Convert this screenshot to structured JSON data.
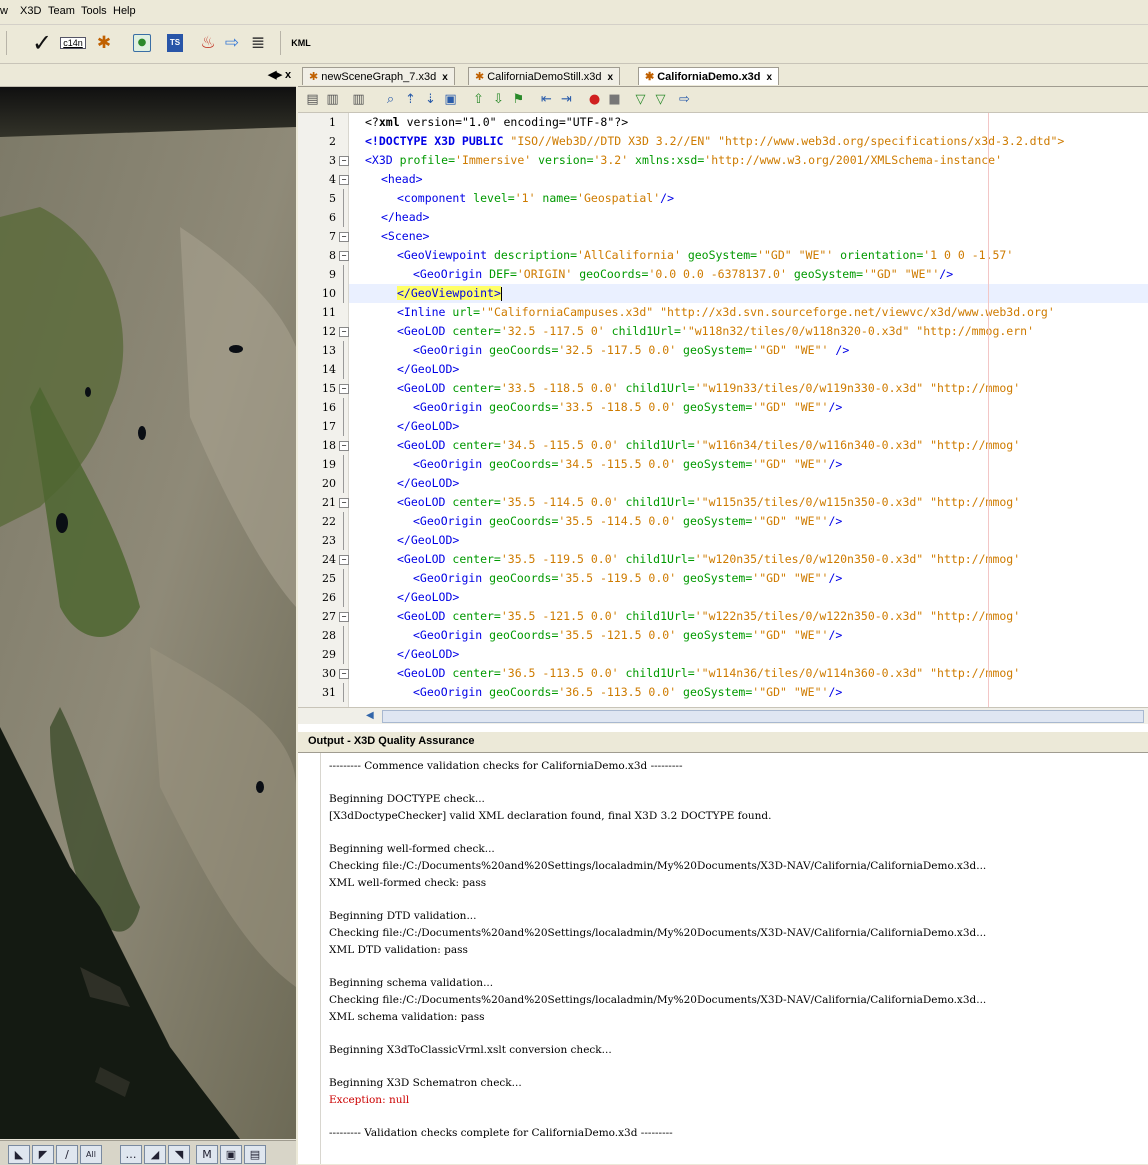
{
  "menu": [
    "w",
    "X3D",
    "Team",
    "Tools",
    "Help"
  ],
  "toolbar": {
    "c14n_label": "c14n",
    "ts_label": "TS",
    "kml_label": "KML"
  },
  "left_panel": {
    "controls": "◀▸ x"
  },
  "map_controls": [
    "◣",
    "◤",
    "∕",
    "All",
    "…",
    "◢",
    "◥",
    "M",
    "▣",
    "▤"
  ],
  "editor": {
    "tabs": [
      {
        "label": "newSceneGraph_7.x3d",
        "close": "x"
      },
      {
        "label": "CaliforniaDemoStill.x3d",
        "close": "x"
      },
      {
        "label": "CaliforniaDemo.x3d",
        "close": "x"
      }
    ],
    "lines": [
      {
        "n": "1"
      },
      {
        "n": "2"
      },
      {
        "n": "3"
      },
      {
        "n": "4"
      },
      {
        "n": "5"
      },
      {
        "n": "6"
      },
      {
        "n": "7"
      },
      {
        "n": "8"
      },
      {
        "n": "9"
      },
      {
        "n": "10"
      },
      {
        "n": "11"
      },
      {
        "n": "12"
      },
      {
        "n": "13"
      },
      {
        "n": "14"
      },
      {
        "n": "15"
      },
      {
        "n": "16"
      },
      {
        "n": "17"
      },
      {
        "n": "18"
      },
      {
        "n": "19"
      },
      {
        "n": "20"
      },
      {
        "n": "21"
      },
      {
        "n": "22"
      },
      {
        "n": "23"
      },
      {
        "n": "24"
      },
      {
        "n": "25"
      },
      {
        "n": "26"
      },
      {
        "n": "27"
      },
      {
        "n": "28"
      },
      {
        "n": "29"
      },
      {
        "n": "30"
      },
      {
        "n": "31"
      }
    ],
    "code": {
      "l1": {
        "a": "<?",
        "b": "xml",
        "c": " version=\"1.0\" encoding=\"UTF-8\"?>"
      },
      "l2": {
        "a": "<!DOCTYPE X3D PUBLIC ",
        "b": "\"ISO//Web3D//DTD X3D 3.2//EN\" \"http://www.web3d.org/specifications/x3d-3.2.dtd\">"
      },
      "l3": {
        "a": "<X3D",
        "b": " profile=",
        "c": "'Immersive'",
        "d": " version=",
        "e": "'3.2'",
        "f": " xmlns:xsd=",
        "g": "'http://www.w3.org/2001/XMLSchema-instance'"
      },
      "l4": {
        "a": "<head>"
      },
      "l5": {
        "a": "<component",
        "b": " level=",
        "c": "'1'",
        "d": " name=",
        "e": "'Geospatial'",
        "f": "/>"
      },
      "l6": {
        "a": "</head>"
      },
      "l7": {
        "a": "<Scene>"
      },
      "l8": {
        "a": "<GeoViewpoint",
        "b": " description=",
        "c": "'AllCalifornia'",
        "d": " geoSystem=",
        "e": "'\"GD\" \"WE\"'",
        "f": " orientation=",
        "g": "'1 0 0 -1.57'"
      },
      "l9": {
        "a": "<GeoOrigin",
        "b": " DEF=",
        "c": "'ORIGIN'",
        "d": " geoCoords=",
        "e": "'0.0 0.0 -6378137.0'",
        "f": " geoSystem=",
        "g": "'\"GD\" \"WE\"'",
        "h": "/>"
      },
      "l10": {
        "a": "</GeoViewpoint",
        "b": ">"
      },
      "l11": {
        "a": "<Inline",
        "b": " url=",
        "c": "'\"CaliforniaCampuses.x3d\" \"http://x3d.svn.sourceforge.net/viewvc/x3d/www.web3d.org'"
      },
      "geolod": [
        {
          "c": "'32.5 -117.5 0'",
          "u": "'\"w118n32/tiles/0/w118n320-0.x3d\" \"http://mmog.ern'",
          "o": "'32.5 -117.5 0.0'",
          "end": " />"
        },
        {
          "c": "'33.5 -118.5 0.0'",
          "u": "'\"w119n33/tiles/0/w119n330-0.x3d\" \"http://mmog'",
          "o": "'33.5 -118.5 0.0'",
          "end": "/>"
        },
        {
          "c": "'34.5 -115.5 0.0'",
          "u": "'\"w116n34/tiles/0/w116n340-0.x3d\" \"http://mmog'",
          "o": "'34.5 -115.5 0.0'",
          "end": "/>"
        },
        {
          "c": "'35.5 -114.5 0.0'",
          "u": "'\"w115n35/tiles/0/w115n350-0.x3d\" \"http://mmog'",
          "o": "'35.5 -114.5 0.0'",
          "end": "/>"
        },
        {
          "c": "'35.5 -119.5 0.0'",
          "u": "'\"w120n35/tiles/0/w120n350-0.x3d\" \"http://mmog'",
          "o": "'35.5 -119.5 0.0'",
          "end": "/>"
        },
        {
          "c": "'35.5 -121.5 0.0'",
          "u": "'\"w122n35/tiles/0/w122n350-0.x3d\" \"http://mmog'",
          "o": "'35.5 -121.5 0.0'",
          "end": "/>"
        },
        {
          "c": "'36.5 -113.5 0.0'",
          "u": "'\"w114n36/tiles/0/w114n360-0.x3d\" \"http://mmog'",
          "o": "'36.5 -113.5 0.0'",
          "end": "/>"
        }
      ],
      "geolod_tag": "<GeoLOD",
      "geolod_close": "</GeoLOD>",
      "center_attr": " center=",
      "child_attr": " child1Url=",
      "origin_tag": "<GeoOrigin",
      "coords_attr": " geoCoords=",
      "system_attr": " geoSystem=",
      "system_val": "'\"GD\" \"WE\"'"
    }
  },
  "output": {
    "title": "Output - X3D Quality Assurance",
    "lines": [
      {
        "text": "--------- Commence validation checks for CaliforniaDemo.x3d ---------",
        "err": false
      },
      {
        "text": "Beginning DOCTYPE check...",
        "err": false
      },
      {
        "text": "[X3dDoctypeChecker] valid XML declaration found, final X3D 3.2 DOCTYPE found.",
        "err": false
      },
      {
        "text": "Beginning well-formed check...",
        "err": false
      },
      {
        "text": "Checking file:/C:/Documents%20and%20Settings/localadmin/My%20Documents/X3D-NAV/California/CaliforniaDemo.x3d...",
        "err": false
      },
      {
        "text": "XML well-formed check: pass",
        "err": false
      },
      {
        "text": "Beginning DTD validation...",
        "err": false
      },
      {
        "text": "Checking file:/C:/Documents%20and%20Settings/localadmin/My%20Documents/X3D-NAV/California/CaliforniaDemo.x3d...",
        "err": false
      },
      {
        "text": "XML DTD validation: pass",
        "err": false
      },
      {
        "text": "Beginning schema validation...",
        "err": false
      },
      {
        "text": "Checking file:/C:/Documents%20and%20Settings/localadmin/My%20Documents/X3D-NAV/California/CaliforniaDemo.x3d...",
        "err": false
      },
      {
        "text": "XML schema validation: pass",
        "err": false
      },
      {
        "text": "Beginning X3dToClassicVrml.xslt conversion check...",
        "err": false
      },
      {
        "text": "Beginning X3D Schematron check...",
        "err": false
      },
      {
        "text": "Exception: null",
        "err": true
      },
      {
        "text": "--------- Validation checks complete for CaliforniaDemo.x3d ---------",
        "err": false
      }
    ]
  }
}
